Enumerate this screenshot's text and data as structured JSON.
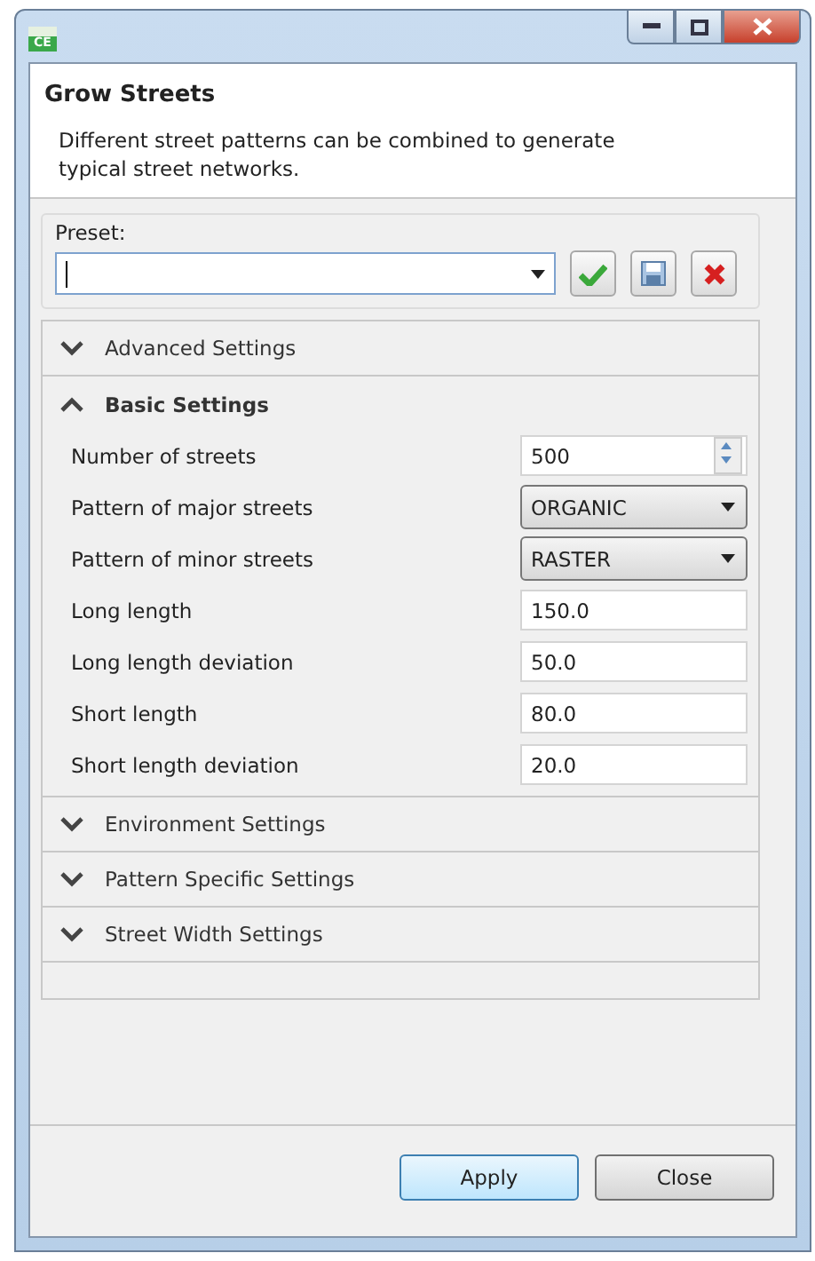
{
  "window": {
    "icon_text": "CE"
  },
  "header": {
    "title": "Grow Streets",
    "description": "Different street patterns can be combined to generate typical street networks."
  },
  "preset": {
    "label": "Preset:"
  },
  "sections": [
    {
      "title": "Advanced Settings",
      "expanded": false
    },
    {
      "title": "Basic Settings",
      "expanded": true,
      "fields": [
        {
          "label": "Number of streets",
          "kind": "spinner",
          "value": "500"
        },
        {
          "label": "Pattern of major streets",
          "kind": "dropdown",
          "value": "ORGANIC"
        },
        {
          "label": "Pattern of minor streets",
          "kind": "dropdown",
          "value": "RASTER"
        },
        {
          "label": "Long length",
          "kind": "text",
          "value": "150.0"
        },
        {
          "label": "Long length deviation",
          "kind": "text",
          "value": "50.0"
        },
        {
          "label": "Short length",
          "kind": "text",
          "value": "80.0"
        },
        {
          "label": "Short length deviation",
          "kind": "text",
          "value": "20.0"
        }
      ]
    },
    {
      "title": "Environment Settings",
      "expanded": false
    },
    {
      "title": "Pattern Specific Settings",
      "expanded": false
    },
    {
      "title": "Street Width Settings",
      "expanded": false
    }
  ],
  "buttons": [
    {
      "label": "Apply",
      "default": true
    },
    {
      "label": "Close",
      "default": false
    }
  ]
}
